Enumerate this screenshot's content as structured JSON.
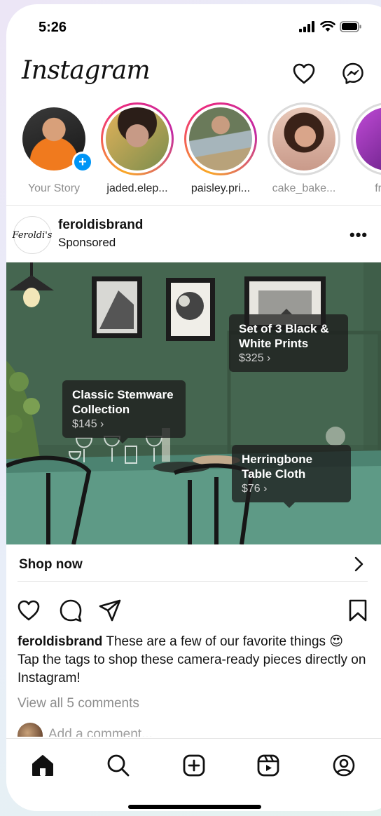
{
  "status_bar": {
    "time": "5:26"
  },
  "header": {
    "logo": "Instagram"
  },
  "stories": [
    {
      "label": "Your Story",
      "own": true
    },
    {
      "label": "jaded.elep...",
      "own": false
    },
    {
      "label": "paisley.pri...",
      "own": false
    },
    {
      "label": "cake_bake...",
      "own": false
    },
    {
      "label": "frenc",
      "own": false
    }
  ],
  "post": {
    "brand_avatar_text": "Feroldi's",
    "username": "feroldisbrand",
    "subtitle": "Sponsored",
    "more": "•••",
    "tags": [
      {
        "title_line1": "Set of 3 Black &",
        "title_line2": "White Prints",
        "price": "$325 ›"
      },
      {
        "title_line1": "Classic Stemware",
        "title_line2": "Collection",
        "price": "$145 ›"
      },
      {
        "title_line1": "Herringbone",
        "title_line2": "Table Cloth",
        "price": "$76 ›"
      }
    ],
    "shop_now": "Shop now",
    "caption_user": "feroldisbrand",
    "caption_text": " These are a few of our favorite things 😍 Tap the tags to shop these camera-ready pieces directly on Instagram!",
    "view_comments": "View all 5 comments",
    "add_comment": "Add a comment..."
  },
  "colors": {
    "accent_blue": "#0095f6",
    "story_ring_start": "#f9a826",
    "story_ring_end": "#c32aa3"
  }
}
